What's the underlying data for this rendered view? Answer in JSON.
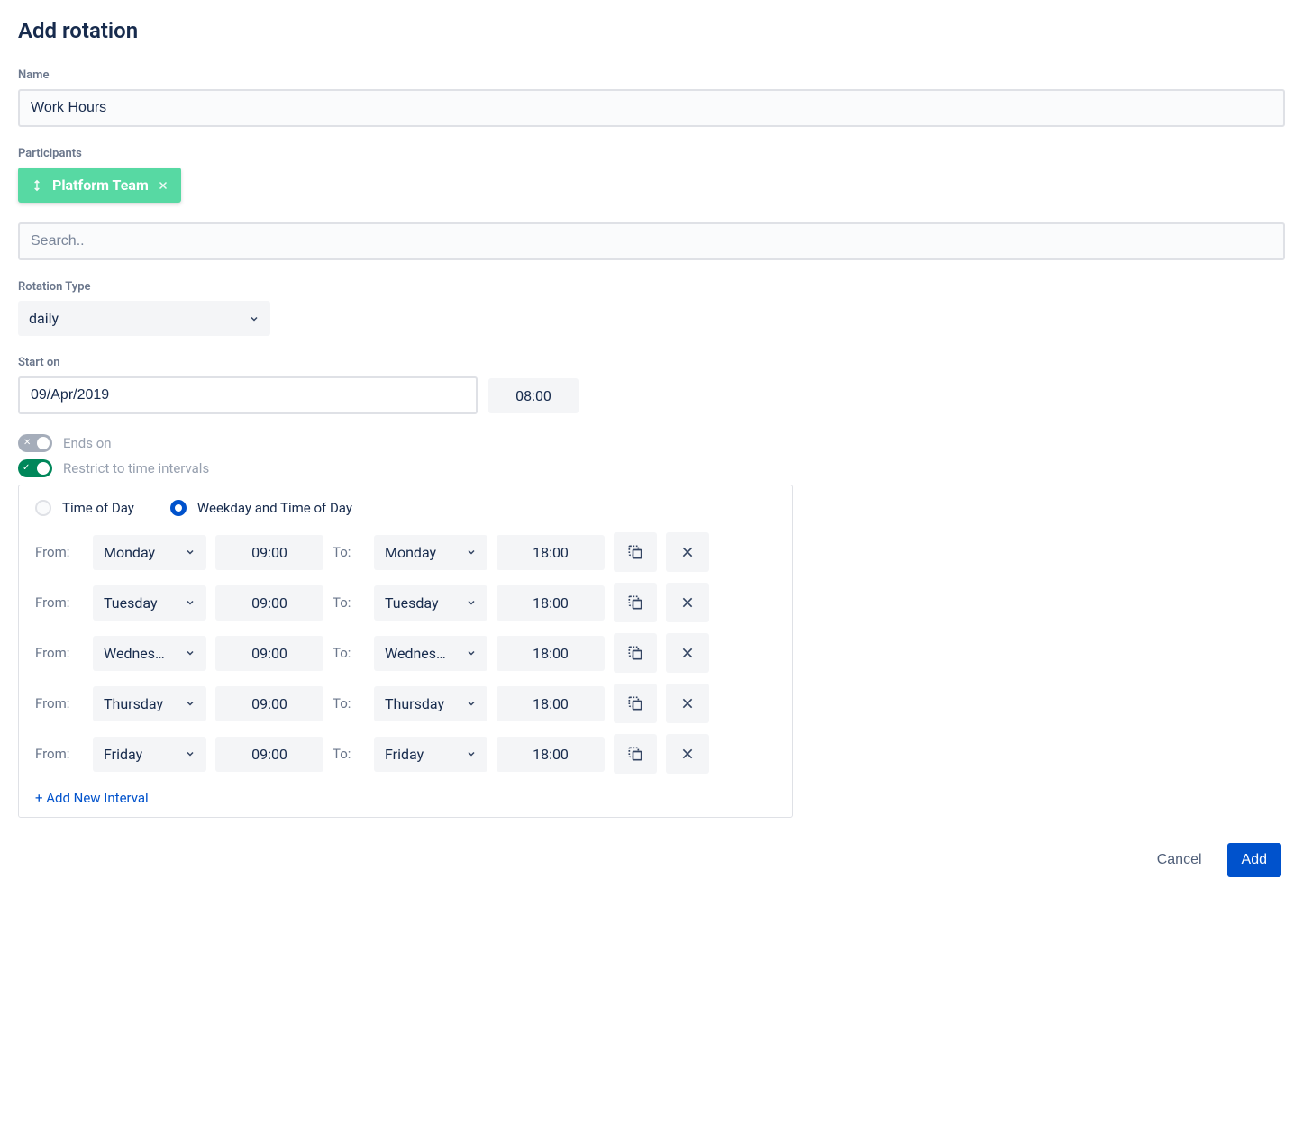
{
  "title": "Add rotation",
  "name": {
    "label": "Name",
    "value": "Work Hours"
  },
  "participants": {
    "label": "Participants",
    "items": [
      {
        "name": "Platform Team"
      }
    ],
    "search_placeholder": "Search.."
  },
  "rotationType": {
    "label": "Rotation Type",
    "value": "daily"
  },
  "startOn": {
    "label": "Start on",
    "date": "09/Apr/2019",
    "time": "08:00"
  },
  "toggles": {
    "endsOn": {
      "label": "Ends on",
      "on": false
    },
    "restrict": {
      "label": "Restrict to time intervals",
      "on": true
    }
  },
  "restrictPanel": {
    "option1": "Time of Day",
    "option2": "Weekday and Time of Day",
    "selected": "option2",
    "fromLabel": "From:",
    "toLabel": "To:",
    "intervals": [
      {
        "fromDay": "Monday",
        "fromTime": "09:00",
        "toDay": "Monday",
        "toTime": "18:00"
      },
      {
        "fromDay": "Tuesday",
        "fromTime": "09:00",
        "toDay": "Tuesday",
        "toTime": "18:00"
      },
      {
        "fromDay": "Wednes…",
        "fromTime": "09:00",
        "toDay": "Wednes…",
        "toTime": "18:00"
      },
      {
        "fromDay": "Thursday",
        "fromTime": "09:00",
        "toDay": "Thursday",
        "toTime": "18:00"
      },
      {
        "fromDay": "Friday",
        "fromTime": "09:00",
        "toDay": "Friday",
        "toTime": "18:00"
      }
    ],
    "addLink": "+ Add New Interval"
  },
  "footer": {
    "cancel": "Cancel",
    "add": "Add"
  }
}
